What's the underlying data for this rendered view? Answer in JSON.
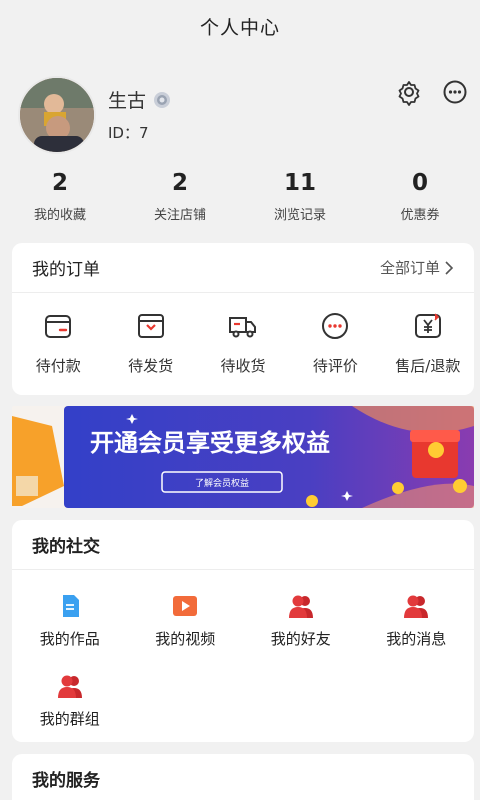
{
  "header": {
    "title": "个人中心"
  },
  "profile": {
    "name": "生古",
    "id_text": "ID：7",
    "icons": {
      "settings": "gear-icon",
      "messages": "chat-bubble-icon",
      "badge": "medal-icon"
    }
  },
  "stats": [
    {
      "value": "2",
      "label": "我的收藏"
    },
    {
      "value": "2",
      "label": "关注店铺"
    },
    {
      "value": "11",
      "label": "浏览记录"
    },
    {
      "value": "0",
      "label": "优惠券"
    }
  ],
  "orders": {
    "title": "我的订单",
    "all_label": "全部订单",
    "items": [
      {
        "label": "待付款",
        "icon": "wallet-icon"
      },
      {
        "label": "待发货",
        "icon": "package-icon"
      },
      {
        "label": "待收货",
        "icon": "truck-icon"
      },
      {
        "label": "待评价",
        "icon": "comment-icon"
      },
      {
        "label": "售后/退款",
        "icon": "refund-icon"
      }
    ]
  },
  "banner": {
    "headline": "开通会员享受更多权益",
    "button": "了解会员权益"
  },
  "social": {
    "title": "我的社交",
    "items": [
      {
        "label": "我的作品",
        "icon": "document-icon"
      },
      {
        "label": "我的视频",
        "icon": "video-icon"
      },
      {
        "label": "我的好友",
        "icon": "friends-icon"
      },
      {
        "label": "我的消息",
        "icon": "message-user-icon"
      },
      {
        "label": "我的群组",
        "icon": "group-icon"
      }
    ]
  },
  "services": {
    "title": "我的服务"
  },
  "colors": {
    "accent": "#e8382f",
    "banner_blue": "#3b44c6",
    "banner_purple": "#7b3fb5"
  }
}
